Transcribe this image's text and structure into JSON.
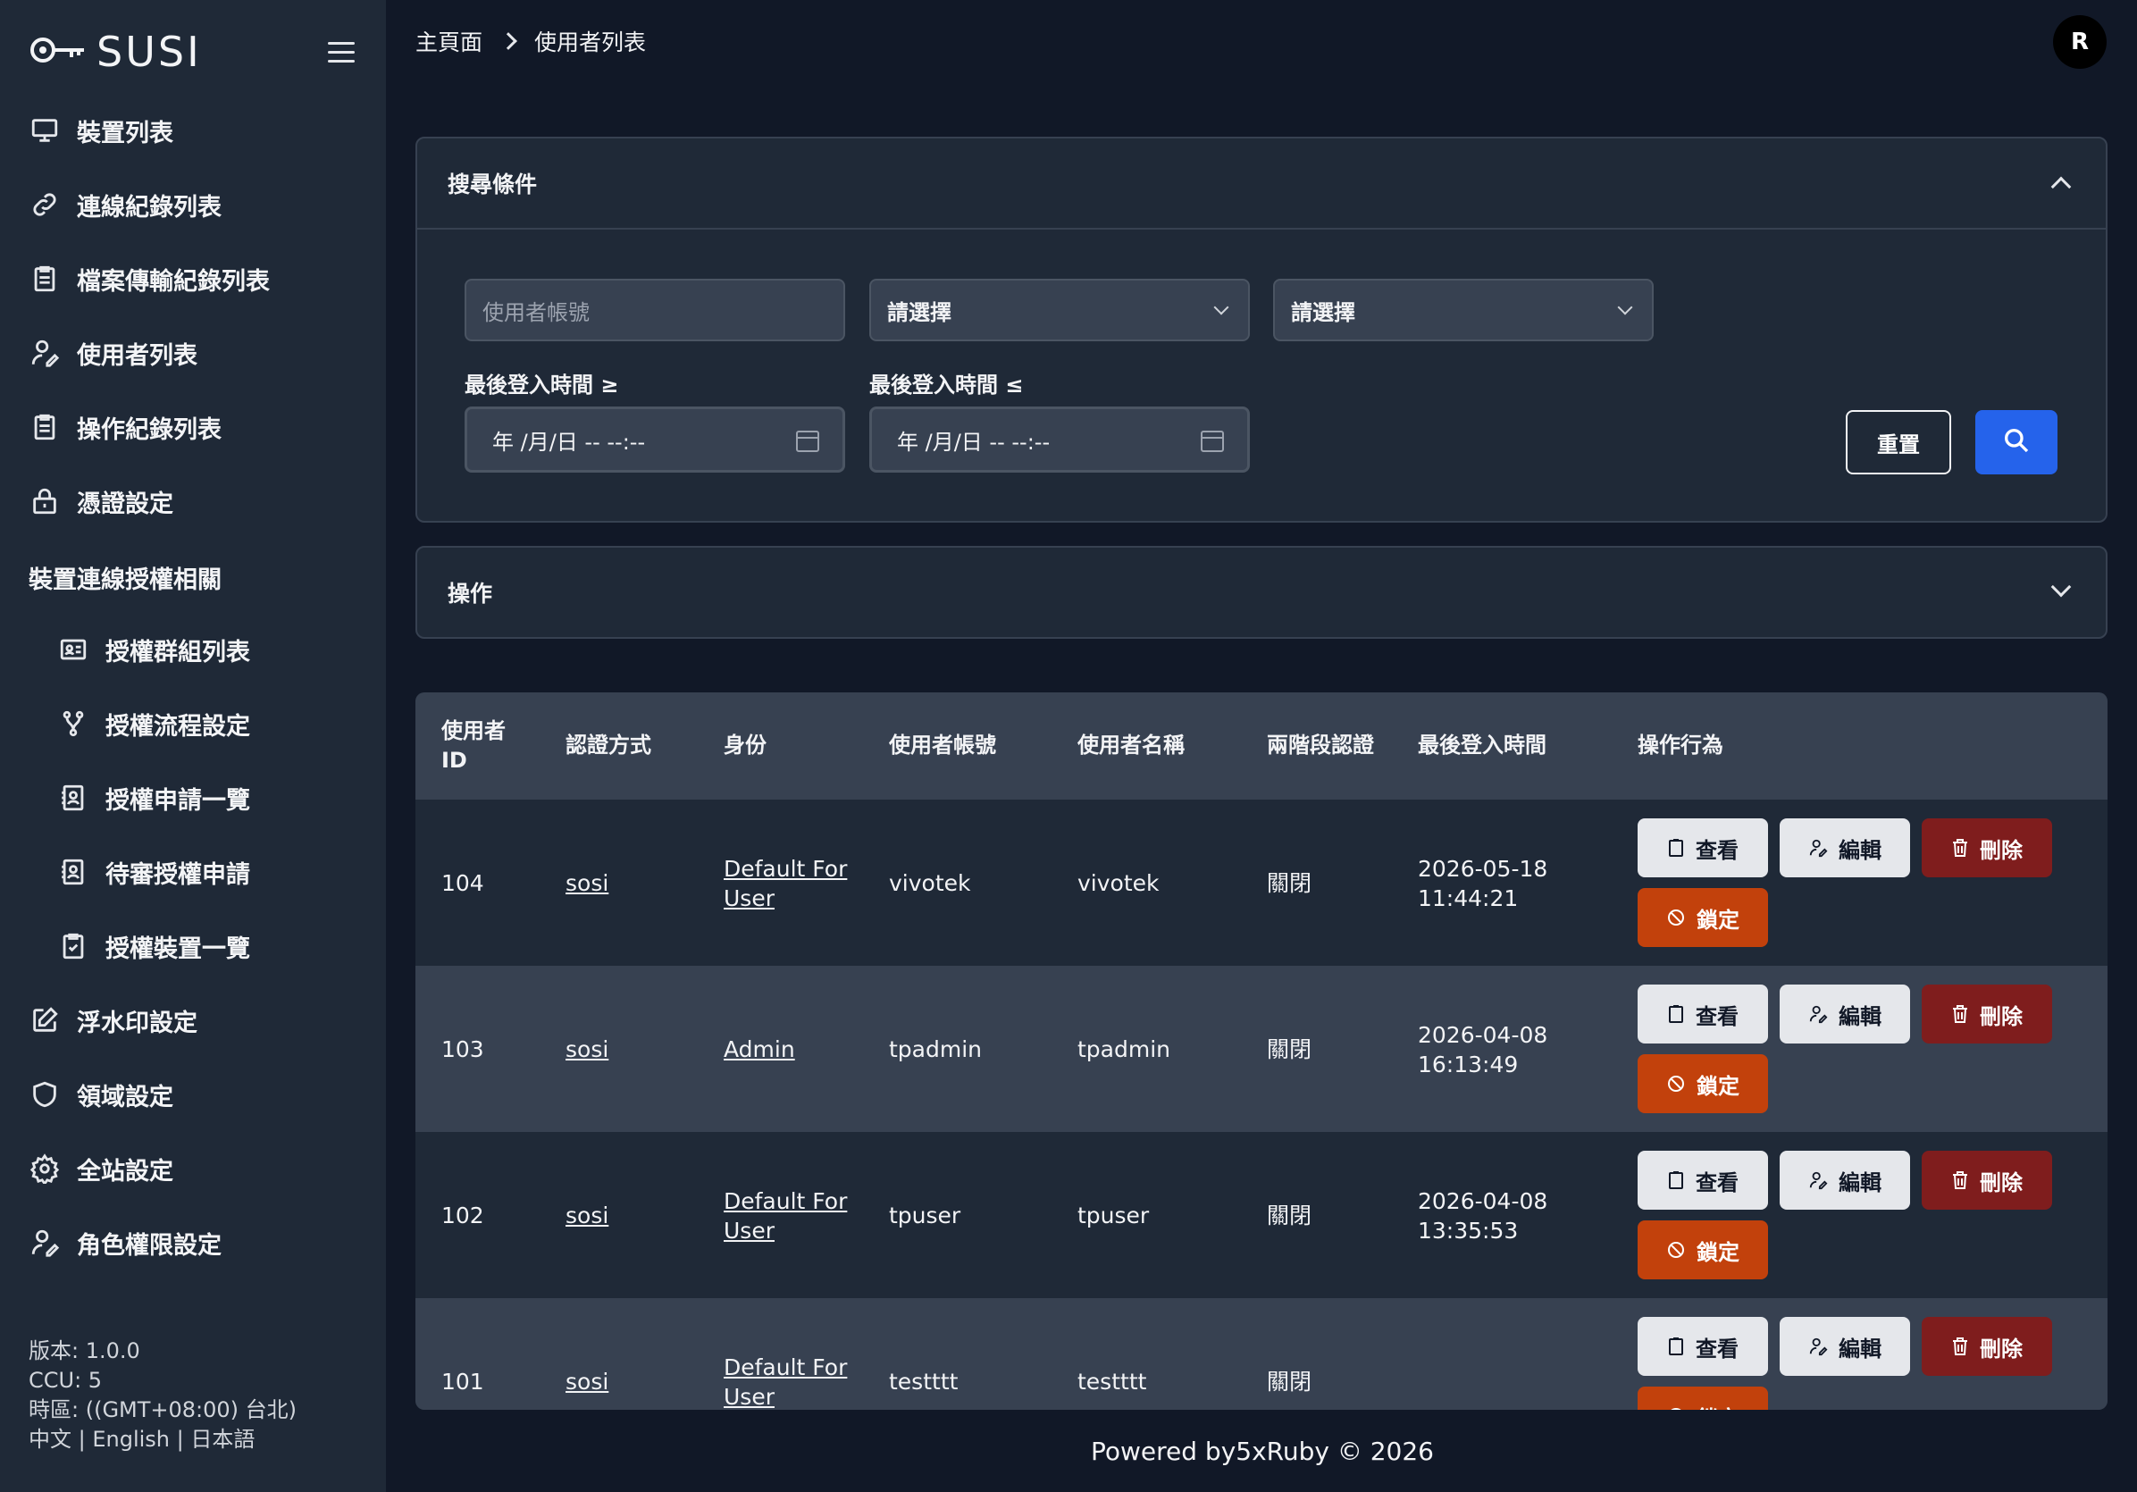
{
  "brand": {
    "name": "SUSI"
  },
  "sidebar": {
    "items": [
      {
        "label": "裝置列表",
        "icon": "monitor-icon"
      },
      {
        "label": "連線紀錄列表",
        "icon": "link-icon"
      },
      {
        "label": "檔案傳輸紀錄列表",
        "icon": "clipboard-list-icon"
      },
      {
        "label": "使用者列表",
        "icon": "user-edit-icon"
      },
      {
        "label": "操作紀錄列表",
        "icon": "clipboard-list-icon"
      },
      {
        "label": "憑證設定",
        "icon": "lock-icon"
      }
    ],
    "section_heading": "裝置連線授權相關",
    "sub_items": [
      {
        "label": "授權群組列表",
        "icon": "id-card-icon"
      },
      {
        "label": "授權流程設定",
        "icon": "git-branch-icon"
      },
      {
        "label": "授權申請一覽",
        "icon": "contact-book-icon"
      },
      {
        "label": "待審授權申請",
        "icon": "contact-book-icon"
      },
      {
        "label": "授權裝置一覽",
        "icon": "clipboard-check-icon"
      }
    ],
    "bottom_items": [
      {
        "label": "浮水印設定",
        "icon": "pen-square-icon"
      },
      {
        "label": "領域設定",
        "icon": "shield-icon"
      },
      {
        "label": "全站設定",
        "icon": "gear-icon"
      },
      {
        "label": "角色權限設定",
        "icon": "user-edit-icon"
      }
    ],
    "footer": {
      "version": "版本: 1.0.0",
      "ccu": "CCU: 5",
      "timezone": "時區: ((GMT+08:00) 台北)",
      "languages": "中文 | English | 日本語"
    }
  },
  "header": {
    "breadcrumb": [
      "主頁面",
      "使用者列表"
    ],
    "avatar_initial": "R"
  },
  "search_panel": {
    "title": "搜尋條件",
    "account_placeholder": "使用者帳號",
    "select1": "請選擇",
    "select2": "請選擇",
    "login_after_label": "最後登入時間 ≥",
    "login_before_label": "最後登入時間 ≤",
    "date_placeholder": "年 /月/日 -- --:--",
    "reset_label": "重置"
  },
  "actions_panel": {
    "title": "操作"
  },
  "table": {
    "headers": [
      "使用者ID",
      "認證方式",
      "身份",
      "使用者帳號",
      "使用者名稱",
      "兩階段認證",
      "最後登入時間",
      "操作行為"
    ],
    "header_id_line1": "使用者",
    "header_id_line2": "ID",
    "action_labels": {
      "view": "查看",
      "edit": "編輯",
      "delete": "刪除",
      "lock": "鎖定"
    },
    "rows": [
      {
        "id": "104",
        "auth": "sosi",
        "role_line1": "Default For",
        "role_line2": "User",
        "account": "vivotek",
        "name": "vivotek",
        "two_factor": "關閉",
        "last_login_date": "2026-05-18",
        "last_login_time": "11:44:21"
      },
      {
        "id": "103",
        "auth": "sosi",
        "role_line1": "Admin",
        "role_line2": "",
        "account": "tpadmin",
        "name": "tpadmin",
        "two_factor": "關閉",
        "last_login_date": "2026-04-08",
        "last_login_time": "16:13:49"
      },
      {
        "id": "102",
        "auth": "sosi",
        "role_line1": "Default For",
        "role_line2": "User",
        "account": "tpuser",
        "name": "tpuser",
        "two_factor": "關閉",
        "last_login_date": "2026-04-08",
        "last_login_time": "13:35:53"
      },
      {
        "id": "101",
        "auth": "sosi",
        "role_line1": "Default For",
        "role_line2": "User",
        "account": "testttt",
        "name": "testttt",
        "two_factor": "關閉",
        "last_login_date": "",
        "last_login_time": ""
      }
    ]
  },
  "footer": {
    "powered": "Powered by5xRuby © 2026"
  },
  "colors": {
    "accent": "#2563eb",
    "delete": "#7f1d1d",
    "lock": "#c2410c",
    "sidebar": "#1f2937",
    "background": "#111827"
  }
}
